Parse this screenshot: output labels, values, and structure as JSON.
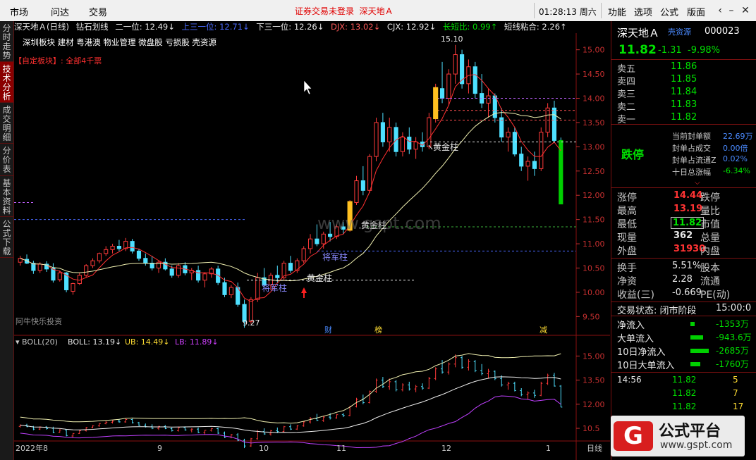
{
  "titlebar": {
    "menu": [
      "市场",
      "问达",
      "交易"
    ],
    "notice": "证券交易未登录",
    "stock": "深天地Ａ",
    "clock": "01:28:13 周六",
    "right_menu": [
      "功能",
      "选项",
      "公式",
      "版面"
    ]
  },
  "side_tabs": [
    "分时走势",
    "技术分析",
    "成交明细",
    "分价表",
    "基本资料",
    "公式下载"
  ],
  "chart_header": {
    "name": "深天地Ａ(日线)",
    "tool": "钻石划线",
    "i1": "二一位: 12.49↓",
    "i2": "上三一位: 12.71↓",
    "i3": "下三一位: 12.26↓",
    "i4": "DJX: 13.02↓",
    "i5": "CJX: 12.92↓",
    "i6": "长短比: 0.99↑",
    "i7": "短线粘合: 2.26↑"
  },
  "concepts": "深圳板块 建材 粤港澳 物业管理 微盘股 亏损股 壳资源",
  "custom_block": "【自定板块】: 全部4千票",
  "main_axis": [
    "15.00",
    "14.50",
    "14.00",
    "13.50",
    "13.00",
    "12.50",
    "12.00",
    "11.50",
    "11.00",
    "10.50",
    "10.00",
    "9.50"
  ],
  "annotations": {
    "high": "15.10",
    "low": "9.27",
    "gold1": "黄金柱",
    "gold2": "黄金柱",
    "gold3": "黄金柱",
    "gen1": "将军柱",
    "gen2": "将军柱",
    "author": "阿牛快乐投资",
    "event1": "财",
    "event2": "榜",
    "event3": "减",
    "watermark": "www.gspt.com"
  },
  "boll_header": {
    "name": "BOLL(20)",
    "boll": "BOLL: 13.19↓",
    "ub": "UB: 14.49↓",
    "lb": "LB: 11.89↓"
  },
  "boll_axis": [
    "15.00",
    "13.50",
    "12.00",
    "10.5"
  ],
  "date_axis": [
    "2022年8",
    "9",
    "10",
    "11",
    "12",
    "1"
  ],
  "period": "日线",
  "panel": {
    "name": "深天地Ａ",
    "tag": "壳资源",
    "code": "000023",
    "price": "11.82",
    "change": "-1.31",
    "pct": "-9.98%",
    "asks": [
      {
        "label": "卖五",
        "price": "11.86"
      },
      {
        "label": "卖四",
        "price": "11.85"
      },
      {
        "label": "卖三",
        "price": "11.84"
      },
      {
        "label": "卖二",
        "price": "11.83"
      },
      {
        "label": "卖一",
        "price": "11.82"
      }
    ],
    "limit_state": "跌停",
    "seal": [
      {
        "label": "当前封单额",
        "value": "22.69万"
      },
      {
        "label": "封单占成交",
        "value": "0.00倍"
      },
      {
        "label": "封单占流通Z",
        "value": "0.02%"
      },
      {
        "label": "十日总涨幅",
        "value": "-6.34%"
      }
    ],
    "quote": [
      {
        "l1": "涨停",
        "v1": "14.44",
        "l2": "跌停"
      },
      {
        "l1": "最高",
        "v1": "13.19",
        "l2": "量比"
      },
      {
        "l1": "最低",
        "v1": "11.82",
        "l2": "市值"
      },
      {
        "l1": "现量",
        "v1": "362",
        "l2": "总量"
      },
      {
        "l1": "外盘",
        "v1": "31930",
        "l2": "内盘"
      }
    ],
    "stats": [
      {
        "l1": "换手",
        "v1": "5.51%",
        "l2": "股本"
      },
      {
        "l1": "净资",
        "v1": "2.28",
        "l2": "流通"
      },
      {
        "l1": "收益(三)",
        "v1": "-0.669",
        "l2": "PE(动)"
      }
    ],
    "trade_state": "交易状态: 闭市阶段",
    "trade_time": "15:00:0",
    "flows": [
      {
        "label": "净流入",
        "value": "-1353万"
      },
      {
        "label": "大单流入",
        "value": "-943.6万"
      },
      {
        "label": "10日净流入",
        "value": "-2685万"
      },
      {
        "label": "10日大单流入",
        "value": "-1760万"
      }
    ],
    "ticks": [
      {
        "time": "14:56",
        "price": "11.82",
        "vol": "5"
      },
      {
        "time": "",
        "price": "11.82",
        "vol": "7"
      },
      {
        "time": "",
        "price": "11.82",
        "vol": "17"
      }
    ]
  },
  "logo": {
    "mark": "G",
    "title": "公式平台",
    "url": "www.gspt.com"
  },
  "chart_data": {
    "type": "candlestick",
    "ylim": [
      9.2,
      15.3
    ],
    "boll_ylim": [
      9.8,
      15.5
    ],
    "ohlc": [
      [
        10.62,
        10.75,
        10.55,
        10.7
      ],
      [
        10.68,
        10.78,
        10.58,
        10.6
      ],
      [
        10.6,
        10.65,
        10.38,
        10.45
      ],
      [
        10.45,
        10.62,
        10.4,
        10.58
      ],
      [
        10.58,
        10.64,
        10.42,
        10.48
      ],
      [
        10.5,
        10.6,
        10.2,
        10.25
      ],
      [
        10.26,
        10.45,
        10.22,
        10.4
      ],
      [
        10.4,
        10.42,
        10.0,
        10.05
      ],
      [
        10.02,
        10.2,
        9.95,
        10.18
      ],
      [
        10.18,
        10.4,
        10.15,
        10.35
      ],
      [
        10.35,
        10.58,
        10.3,
        10.55
      ],
      [
        10.55,
        10.7,
        10.5,
        10.65
      ],
      [
        10.65,
        10.82,
        10.6,
        10.8
      ],
      [
        10.8,
        10.95,
        10.75,
        10.88
      ],
      [
        10.88,
        11.0,
        10.8,
        10.95
      ],
      [
        10.95,
        11.08,
        10.85,
        10.9
      ],
      [
        10.9,
        11.12,
        10.85,
        11.05
      ],
      [
        11.05,
        11.1,
        10.8,
        10.85
      ],
      [
        10.85,
        10.9,
        10.65,
        10.7
      ],
      [
        10.7,
        10.8,
        10.55,
        10.6
      ],
      [
        10.6,
        10.75,
        10.45,
        10.5
      ],
      [
        10.5,
        10.65,
        10.4,
        10.62
      ],
      [
        10.62,
        10.7,
        10.45,
        10.48
      ],
      [
        10.48,
        10.55,
        10.3,
        10.35
      ],
      [
        10.35,
        10.6,
        10.3,
        10.55
      ],
      [
        10.55,
        10.62,
        10.35,
        10.4
      ],
      [
        10.4,
        10.5,
        10.25,
        10.45
      ],
      [
        10.45,
        10.55,
        10.2,
        10.25
      ],
      [
        10.25,
        10.4,
        10.1,
        10.38
      ],
      [
        10.38,
        10.52,
        10.3,
        10.48
      ],
      [
        10.48,
        10.55,
        10.15,
        10.2
      ],
      [
        10.2,
        10.3,
        9.9,
        9.95
      ],
      [
        9.95,
        10.15,
        9.88,
        10.1
      ],
      [
        10.1,
        10.2,
        9.7,
        9.75
      ],
      [
        9.75,
        9.85,
        9.27,
        9.4
      ],
      [
        9.4,
        9.9,
        9.35,
        9.85
      ],
      [
        9.85,
        10.4,
        9.8,
        10.3
      ],
      [
        10.3,
        10.5,
        10.1,
        10.15
      ],
      [
        10.15,
        10.4,
        10.05,
        10.35
      ],
      [
        10.35,
        10.55,
        10.2,
        10.3
      ],
      [
        10.3,
        10.65,
        10.25,
        10.6
      ],
      [
        10.6,
        10.75,
        10.4,
        10.45
      ],
      [
        10.45,
        10.7,
        10.4,
        10.65
      ],
      [
        10.65,
        10.95,
        10.6,
        10.9
      ],
      [
        10.9,
        11.2,
        10.8,
        11.1
      ],
      [
        11.1,
        11.4,
        10.95,
        11.0
      ],
      [
        11.0,
        11.25,
        10.9,
        11.2
      ],
      [
        11.2,
        11.45,
        11.05,
        11.15
      ],
      [
        11.15,
        11.4,
        11.1,
        11.35
      ],
      [
        11.35,
        11.45,
        11.2,
        11.3
      ],
      [
        11.3,
        11.9,
        11.25,
        11.85
      ],
      [
        11.85,
        12.4,
        11.8,
        12.3
      ],
      [
        12.3,
        12.6,
        12.0,
        12.1
      ],
      [
        12.1,
        12.85,
        12.05,
        12.8
      ],
      [
        12.8,
        13.6,
        12.7,
        13.5
      ],
      [
        13.5,
        13.7,
        13.0,
        13.1
      ],
      [
        13.1,
        13.6,
        12.9,
        13.4
      ],
      [
        13.4,
        13.5,
        12.8,
        12.9
      ],
      [
        12.9,
        13.3,
        12.8,
        13.2
      ],
      [
        13.2,
        13.4,
        12.85,
        12.95
      ],
      [
        12.95,
        13.2,
        12.75,
        13.1
      ],
      [
        13.1,
        13.3,
        12.9,
        13.0
      ],
      [
        13.0,
        13.7,
        12.95,
        13.6
      ],
      [
        13.6,
        14.3,
        13.5,
        14.2
      ],
      [
        14.2,
        14.75,
        13.9,
        14.0
      ],
      [
        14.0,
        14.6,
        13.85,
        14.5
      ],
      [
        14.5,
        15.1,
        14.3,
        14.9
      ],
      [
        14.9,
        15.0,
        14.2,
        14.3
      ],
      [
        14.3,
        14.8,
        14.1,
        14.65
      ],
      [
        14.65,
        14.75,
        14.0,
        14.1
      ],
      [
        14.1,
        14.5,
        13.8,
        13.9
      ],
      [
        13.9,
        14.2,
        13.6,
        14.05
      ],
      [
        14.05,
        14.1,
        13.5,
        13.6
      ],
      [
        13.6,
        13.8,
        13.1,
        13.2
      ],
      [
        13.2,
        13.4,
        12.9,
        13.3
      ],
      [
        13.3,
        13.4,
        12.8,
        12.85
      ],
      [
        12.85,
        13.0,
        12.5,
        12.6
      ],
      [
        12.6,
        12.8,
        12.3,
        12.7
      ],
      [
        12.7,
        12.9,
        12.4,
        12.55
      ],
      [
        12.55,
        13.4,
        12.5,
        13.3
      ],
      [
        13.3,
        13.9,
        13.2,
        13.8
      ],
      [
        13.8,
        13.95,
        13.1,
        13.13
      ],
      [
        13.13,
        13.19,
        11.82,
        11.82
      ]
    ],
    "boll_band": {
      "mid": 13.19,
      "ub": 14.49,
      "lb": 11.89
    }
  }
}
